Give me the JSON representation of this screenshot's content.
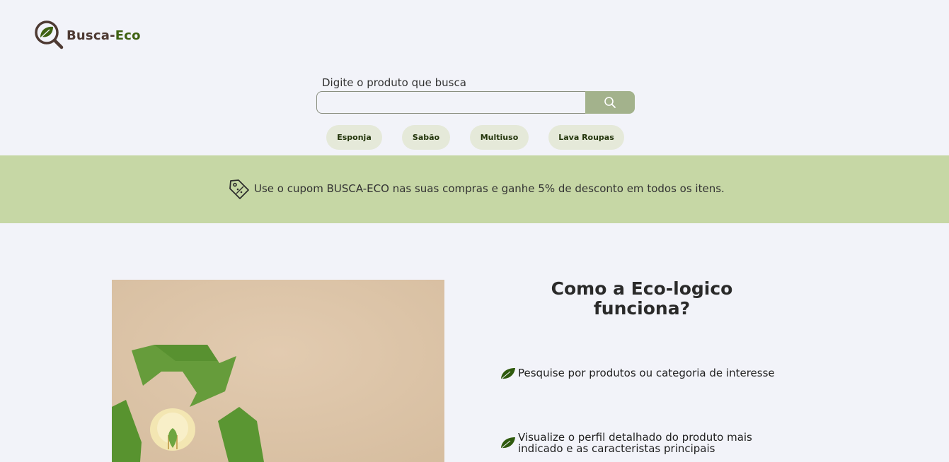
{
  "header": {
    "brand_part1": "Busca-",
    "brand_part2": "Eco",
    "logo_icon": "magnifier-leaf-icon"
  },
  "search": {
    "label": "Digite o produto que busca",
    "placeholder": "",
    "value": "",
    "button_icon": "search-icon"
  },
  "categories": [
    {
      "label": "Esponja"
    },
    {
      "label": "Sabão"
    },
    {
      "label": "Multiuso"
    },
    {
      "label": "Lava Roupas"
    }
  ],
  "promo": {
    "icon": "price-tag-icon",
    "text": "Use o cupom BUSCA-ECO nas suas compras e ganhe 5% de desconto em todos os itens."
  },
  "how_it_works": {
    "title_line1": "Como a Eco-logico",
    "title_line2": "funciona?",
    "steps": [
      {
        "icon": "leaf-icon",
        "text": "Pesquise por produtos ou categoria de interesse"
      },
      {
        "icon": "leaf-icon",
        "text": "Visualize o perfil detalhado do produto mais indicado e as caracteristas principais"
      }
    ]
  },
  "colors": {
    "background": "#f2f3f9",
    "banner": "#c6d7a5",
    "search_button": "#a3b28c",
    "chip": "#e5e9d9",
    "leaf_green": "#2f5a0e",
    "brand_brown": "#4e3a33"
  }
}
